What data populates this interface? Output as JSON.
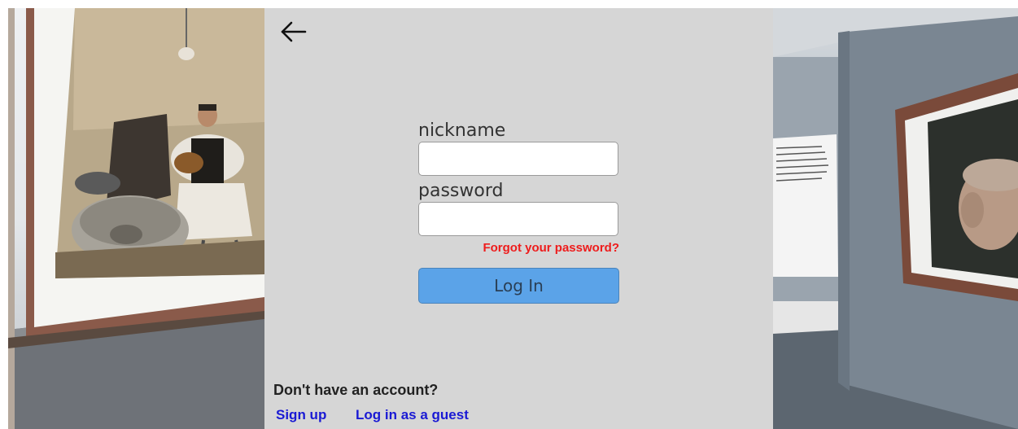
{
  "panel": {
    "back_icon": "arrow-left-icon",
    "nickname_label": "nickname",
    "nickname_value": "",
    "password_label": "password",
    "password_value": "",
    "forgot_password": "Forgot your password?",
    "login_button": "Log In",
    "no_account_text": "Don't have an account?",
    "signup_link": "Sign up",
    "guest_link": "Log in as a guest"
  },
  "colors": {
    "panel_bg": "#d6d6d6",
    "login_button": "#5ba3e8",
    "forgot_link": "#ee1c1c",
    "bottom_links": "#1a1ad4"
  },
  "scene": {
    "left": "gallery wall with painting of a man playing a lute",
    "right": "gallery wall with framed portrait and text plaque"
  }
}
